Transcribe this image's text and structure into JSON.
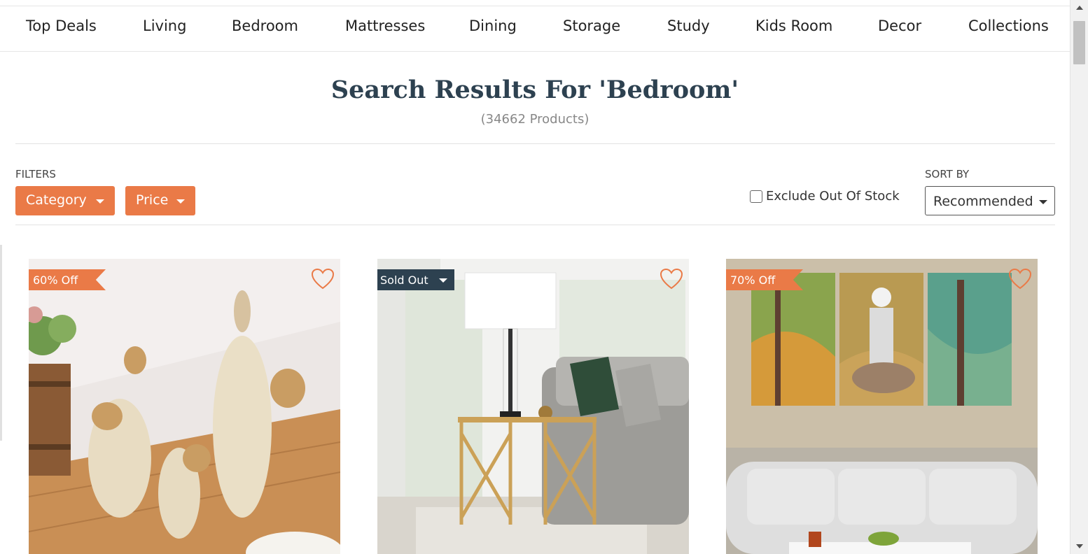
{
  "nav": {
    "items": [
      "Top Deals",
      "Living",
      "Bedroom",
      "Mattresses",
      "Dining",
      "Storage",
      "Study",
      "Kids Room",
      "Decor",
      "Collections"
    ]
  },
  "results": {
    "title": "Search Results For 'Bedroom'",
    "count": "(34662 Products)"
  },
  "filters": {
    "label": "FILTERS",
    "category": "Category",
    "price": "Price",
    "exclude_out_of_stock": "Exclude Out Of Stock",
    "exclude_checked": false
  },
  "sort": {
    "label": "SORT BY",
    "selected": "Recommended"
  },
  "products": [
    {
      "badge": "60% Off",
      "image": "ceramic-elephant-figurines"
    },
    {
      "badge": "Sold Out",
      "image": "glass-table-lamp-on-gold-side-table"
    },
    {
      "badge": "70% Off",
      "image": "three-panel-sai-baba-wall-art-above-sofa"
    }
  ],
  "colors": {
    "accent": "#ea7a47",
    "dark": "#2d4150",
    "heart": "#ea7a47"
  }
}
